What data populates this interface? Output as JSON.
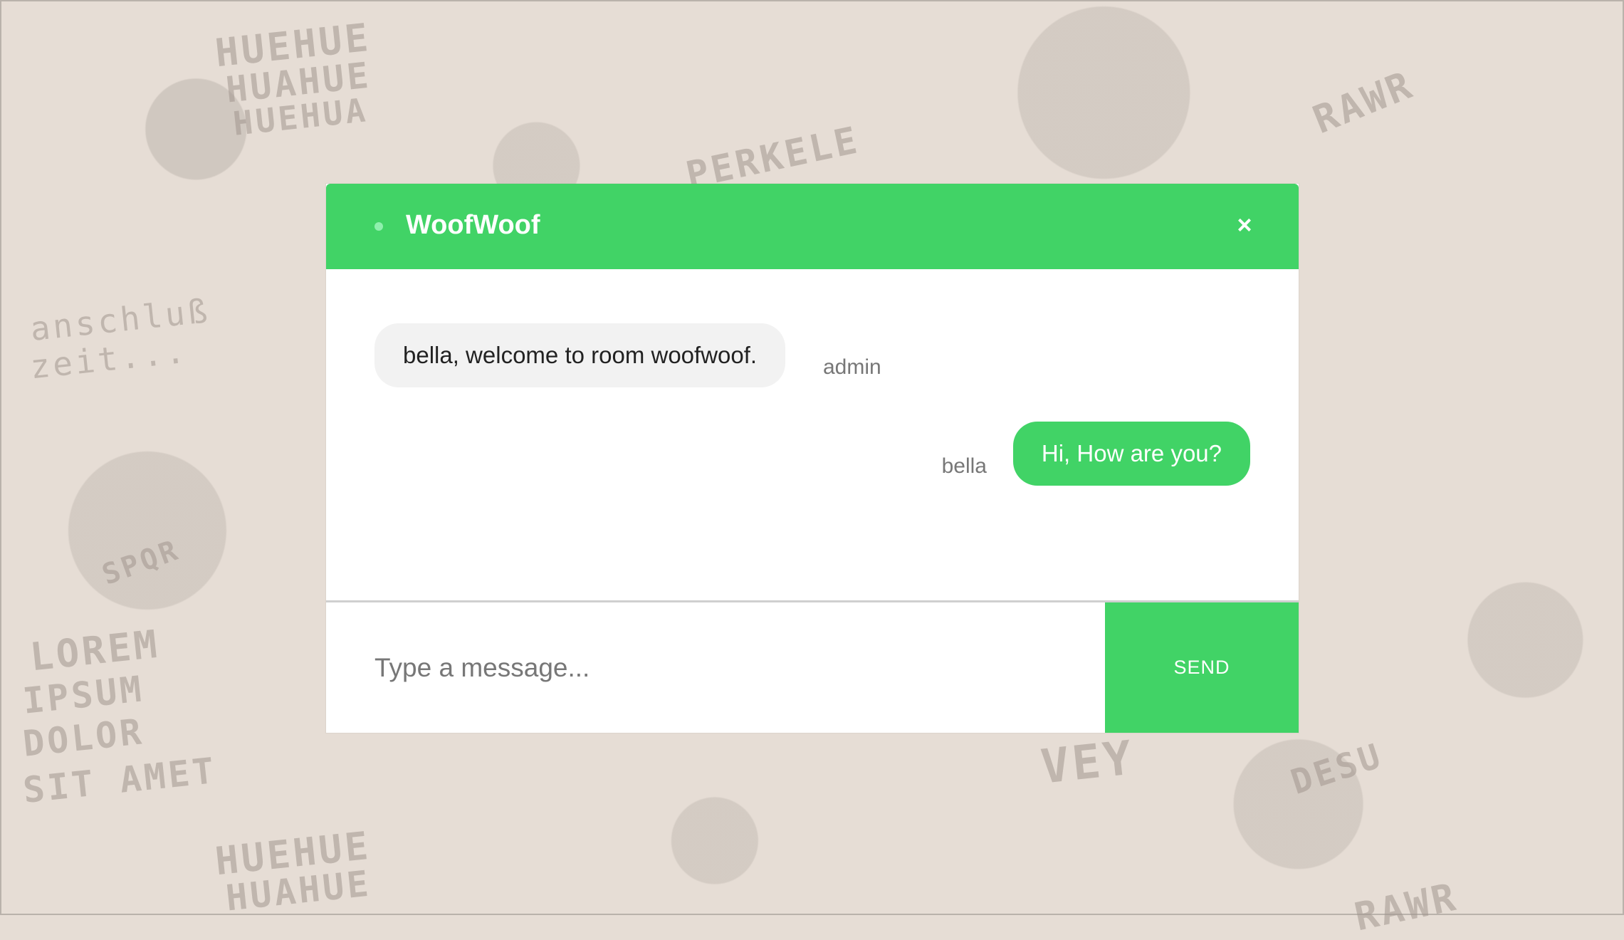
{
  "background": {
    "doodles": [
      "HUEHUE",
      "HUAHUE",
      "HUEHUA",
      "PERKELE",
      "RAWR",
      "anschluß",
      "zeit...",
      "SPQR",
      "LOREM",
      "IPSUM",
      "DOLOR",
      "SIT AMET",
      "VEY",
      "DESU"
    ]
  },
  "header": {
    "room_name": "WoofWoof",
    "status_color": "#8ff0ad",
    "close_icon": "×"
  },
  "messages": [
    {
      "direction": "incoming",
      "text": "bella, welcome to room woofwoof.",
      "sender": "admin"
    },
    {
      "direction": "outgoing",
      "text": "Hi, How are you?",
      "sender": "bella"
    }
  ],
  "composer": {
    "placeholder": "Type a message...",
    "value": "",
    "send_label": "SEND"
  },
  "colors": {
    "accent": "#41d366",
    "background": "#e6ddd5"
  }
}
